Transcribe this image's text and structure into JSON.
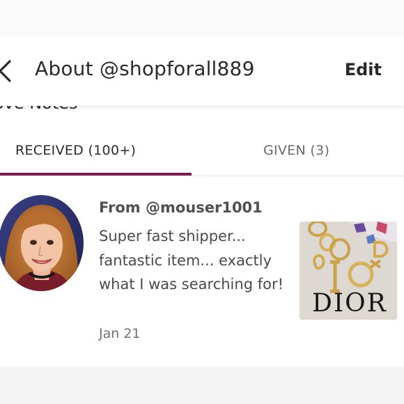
{
  "header": {
    "title": "About @shopforall889",
    "back_icon": "chevron-left-icon",
    "edit_label": "Edit"
  },
  "section": {
    "title": "Love Notes"
  },
  "tabs": [
    {
      "label": "RECEIVED (100+)",
      "active": true
    },
    {
      "label": "GIVEN (3)",
      "active": false
    }
  ],
  "colors": {
    "active_tab_underline": "#7b1d57",
    "text_primary": "#2a2a2a",
    "text_secondary": "#6a6a6a"
  },
  "notes": [
    {
      "from": "From @mouser1001",
      "message": "Super fast shipper... fantastic item... exactly what I was searching for!",
      "date": "Jan 21",
      "item_image_text": "DIOR"
    }
  ]
}
